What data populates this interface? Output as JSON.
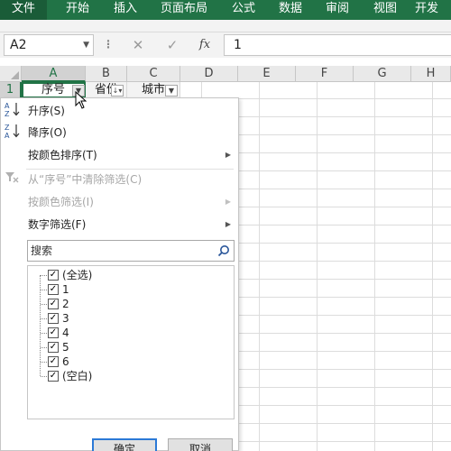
{
  "ribbon": {
    "tabs": [
      {
        "label": "文件",
        "active": true
      },
      {
        "label": "开始"
      },
      {
        "label": "插入"
      },
      {
        "label": "页面布局"
      },
      {
        "label": "公式"
      },
      {
        "label": "数据"
      },
      {
        "label": "审阅"
      },
      {
        "label": "视图"
      },
      {
        "label": "开发"
      }
    ],
    "accent_color": "#217346"
  },
  "formula_bar": {
    "name_box": "A2",
    "cancel_icon": "cancel-x-icon",
    "enter_icon": "enter-check-icon",
    "fx_label": "fx",
    "content": "1"
  },
  "grid": {
    "columns": [
      "A",
      "B",
      "C",
      "D",
      "E",
      "F",
      "G",
      "H"
    ],
    "rows": [
      "1"
    ],
    "row1": {
      "a": "序号",
      "b": "省份",
      "c": "城市"
    }
  },
  "filter_menu": {
    "items": [
      {
        "label": "升序(S)",
        "icon": "sort-ascending-icon",
        "enabled": true
      },
      {
        "label": "降序(O)",
        "icon": "sort-descending-icon",
        "enabled": true
      },
      {
        "label": "按颜色排序(T)",
        "enabled": true,
        "submenu": true
      },
      {
        "label": "从“序号”中清除筛选(C)",
        "icon": "clear-filter-icon",
        "enabled": false
      },
      {
        "label": "按颜色筛选(I)",
        "enabled": false,
        "submenu": true
      },
      {
        "label": "数字筛选(F)",
        "enabled": true,
        "submenu": true
      }
    ],
    "search_placeholder": "搜索",
    "values": [
      {
        "label": "(全选)",
        "checked": true
      },
      {
        "label": "1",
        "checked": true
      },
      {
        "label": "2",
        "checked": true
      },
      {
        "label": "3",
        "checked": true
      },
      {
        "label": "4",
        "checked": true
      },
      {
        "label": "5",
        "checked": true
      },
      {
        "label": "6",
        "checked": true
      },
      {
        "label": "(空白)",
        "checked": true
      }
    ],
    "ok_label": "确定",
    "cancel_label": "取消"
  }
}
